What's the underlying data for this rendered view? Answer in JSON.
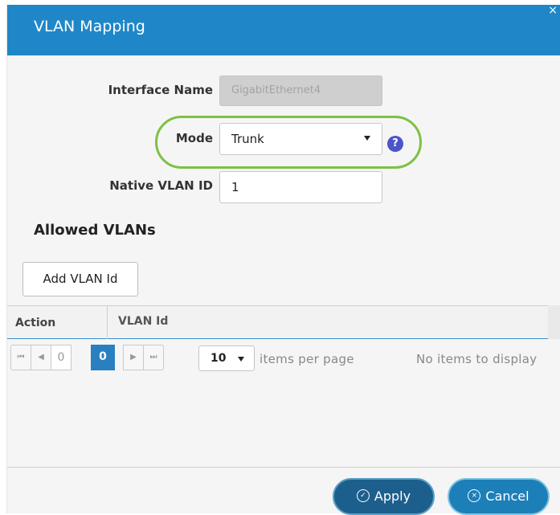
{
  "dialog": {
    "title": "VLAN Mapping",
    "close_glyph": "×",
    "accent_color": "#1f87c8",
    "highlight_color": "#7dc142"
  },
  "form": {
    "interface_name_label": "Interface Name",
    "interface_name_value": "GigabitEthernet4",
    "mode_label": "Mode",
    "mode_value": "Trunk",
    "help_glyph": "?",
    "native_vlan_label": "Native VLAN ID",
    "native_vlan_value": "1"
  },
  "allowed_vlans": {
    "heading": "Allowed VLANs",
    "add_button": "Add VLAN Id",
    "columns": [
      "Action",
      "VLAN Id"
    ]
  },
  "pager": {
    "first_glyph": "⏮",
    "prev_glyph": "◀",
    "next_glyph": "▶",
    "last_glyph": "⏭",
    "page_input": "0",
    "current_page": "0",
    "per_page_value": "10",
    "per_page_label": "items per page",
    "status": "No items to display"
  },
  "footer": {
    "apply_label": "Apply",
    "apply_icon": "check-circle-icon",
    "cancel_label": "Cancel",
    "cancel_icon": "x-circle-icon"
  }
}
